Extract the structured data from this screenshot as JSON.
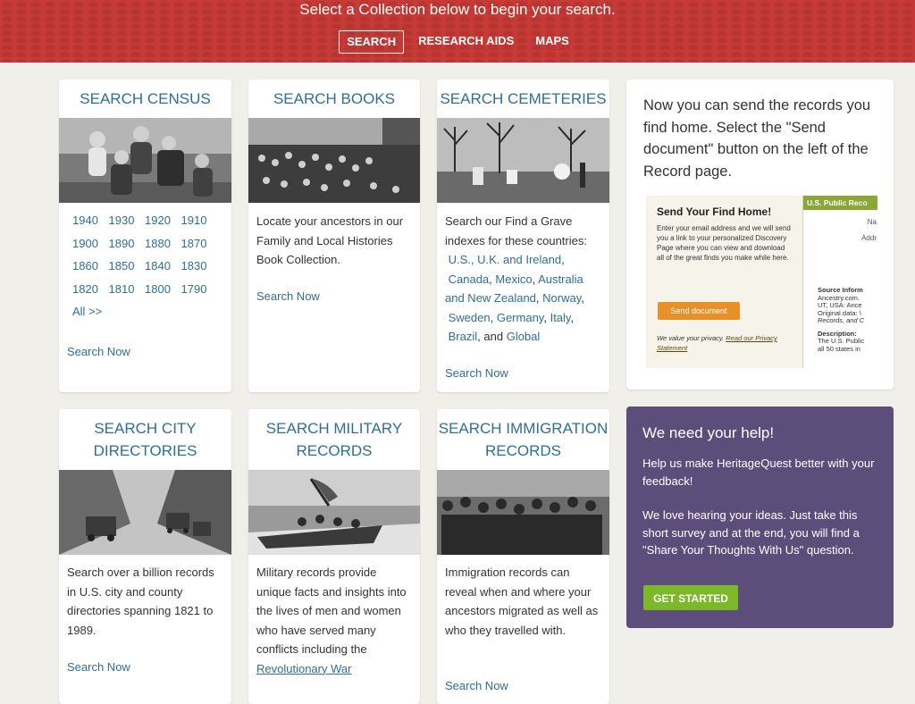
{
  "header": {
    "headline": "Select a Collection below to begin your search.",
    "nav": [
      "SEARCH",
      "RESEARCH AIDS",
      "MAPS"
    ],
    "bg_color": "#c83a36"
  },
  "census": {
    "title": "SEARCH CENSUS",
    "years": [
      [
        "1940",
        "1930",
        "1920",
        "1910"
      ],
      [
        "1900",
        "1890",
        "1880",
        "1870"
      ],
      [
        "1860",
        "1850",
        "1840",
        "1830"
      ],
      [
        "1820",
        "1810",
        "1800",
        "1790"
      ]
    ],
    "all_label": "All >>",
    "search_now": "Search Now"
  },
  "books": {
    "title": "SEARCH BOOKS",
    "text": "Locate your ancestors in our Family and Local Histories Book Collection.",
    "search_now": "Search Now"
  },
  "cemeteries": {
    "title": "SEARCH CEMETERIES",
    "intro": "Search our Find a Grave indexes for these countries:",
    "countries": [
      "U.S., U.K. and Ireland",
      "Canada",
      "Mexico",
      "Australia and New Zealand",
      "Norway",
      "Sweden",
      "Germany",
      "Italy",
      "Brazil",
      "Global"
    ],
    "and_word": "and",
    "search_now": "Search Now"
  },
  "promo": {
    "text": "Now you can send the records you find home. Select the \"Send document\" button on the left of the Record page.",
    "snap": {
      "heading": "Send Your Find Home!",
      "body": "Enter your email address and we will send you a link to your personalized Discovery Page where you can view and download all of the great finds you make while here.",
      "button": "Send document",
      "privacy": "We value your privacy.",
      "privacy_link": "Read our Privacy Statement",
      "record_title": "U.S. Public Reco",
      "na": "Na",
      "addr": "Addr",
      "source_label": "Source Inform",
      "source_lines": [
        "Ancestry.com.",
        "UT, USA: Ance",
        "Original data: \\",
        "Records, and C"
      ],
      "desc_label": "Description:",
      "desc_lines": [
        "The U.S. Public",
        "all 50 states in"
      ]
    }
  },
  "city": {
    "title_lines": [
      "SEARCH CITY",
      "DIRECTORIES"
    ],
    "text": "Search over a billion records in U.S. city and county directories spanning 1821 to 1989.",
    "search_now": "Search Now"
  },
  "military": {
    "title_lines": [
      "SEARCH MILITARY",
      "RECORDS"
    ],
    "text": "Military records provide unique facts and insights into the lives of men and women who have served many conflicts including the",
    "link": "Revolutionary War"
  },
  "immigration": {
    "title_lines": [
      "SEARCH IMMIGRATION",
      "RECORDS"
    ],
    "text": "Immigration records can reveal when and where your ancestors migrated as well as who they travelled with.",
    "search_now": "Search Now"
  },
  "help": {
    "title": "We need your help!",
    "p1": "Help us make HeritageQuest better with your feedback!",
    "p2": "We love hearing your ideas. Just take this short survey and at the end, you will find a \"Share Your Thoughts With Us\" question.",
    "button": "GET STARTED",
    "bg_color": "#5c4d7a"
  }
}
